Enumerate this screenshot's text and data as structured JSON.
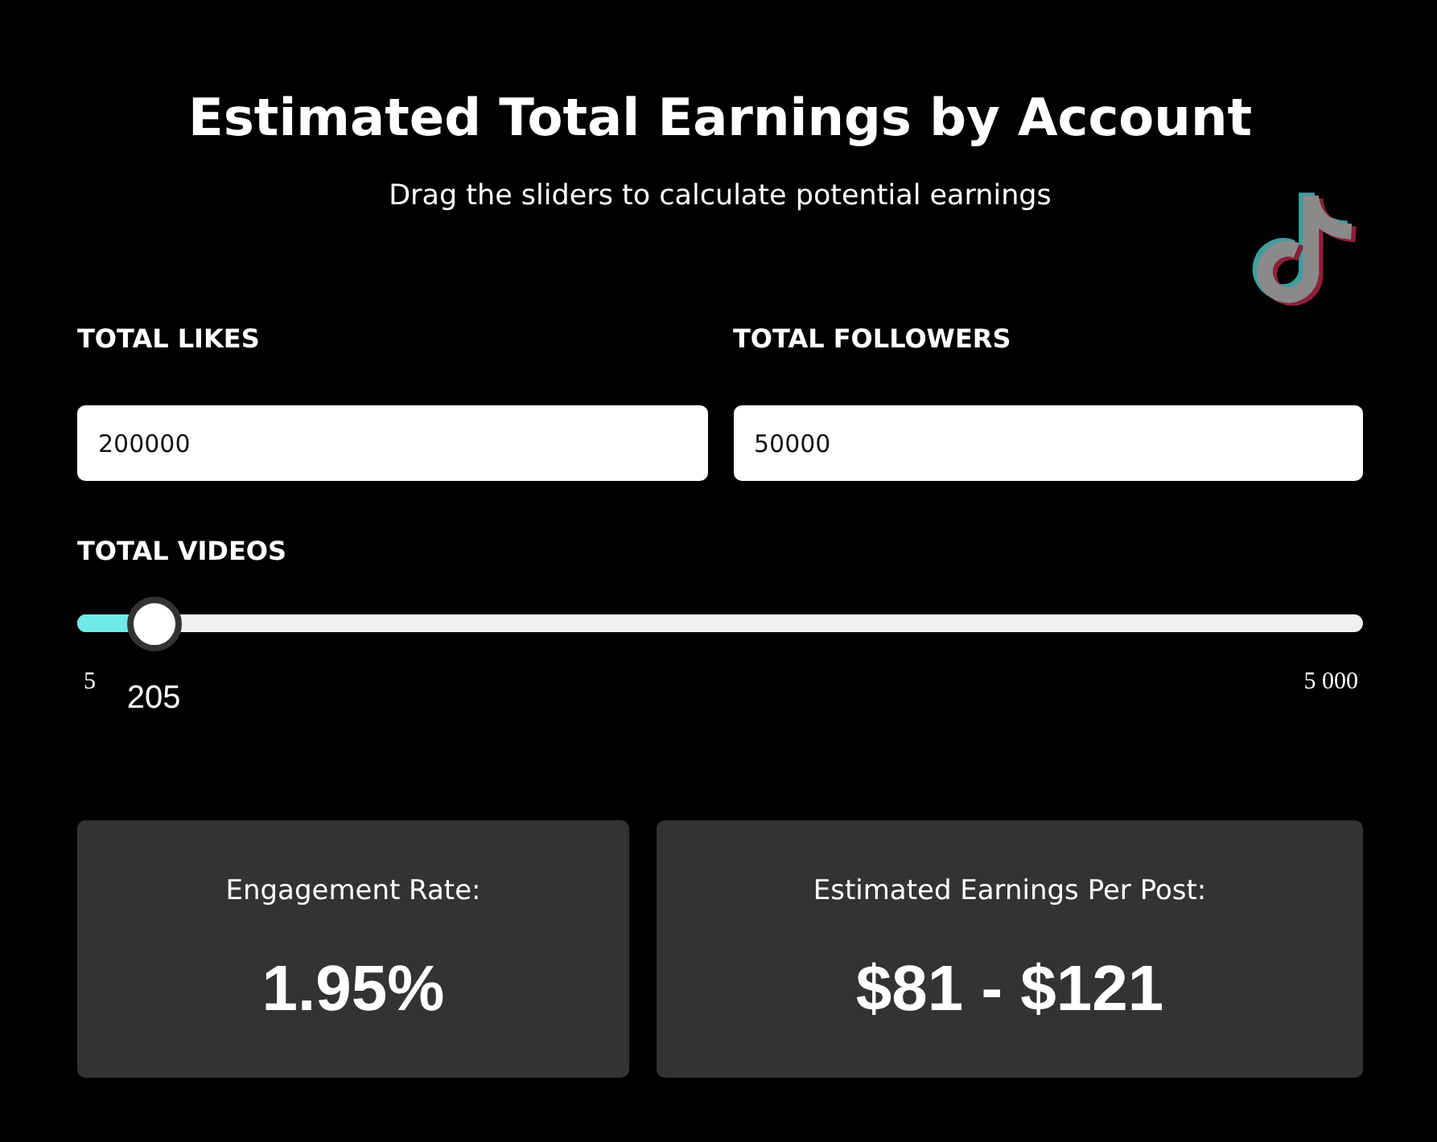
{
  "header": {
    "title": "Estimated Total Earnings by Account",
    "subtitle": "Drag the sliders to calculate potential earnings"
  },
  "inputs": [
    {
      "label": "TOTAL LIKES",
      "value": "200000"
    },
    {
      "label": "TOTAL FOLLOWERS",
      "value": "50000"
    }
  ],
  "slider": {
    "label": "TOTAL VIDEOS",
    "level": 0.04,
    "min_label": "5",
    "max_label": "5 000",
    "reading": "205"
  },
  "results": [
    {
      "label": "Engagement Rate:",
      "value": "1.95%"
    },
    {
      "label": "Estimated Earnings Per Post:",
      "value": "$81 - $121"
    }
  ]
}
